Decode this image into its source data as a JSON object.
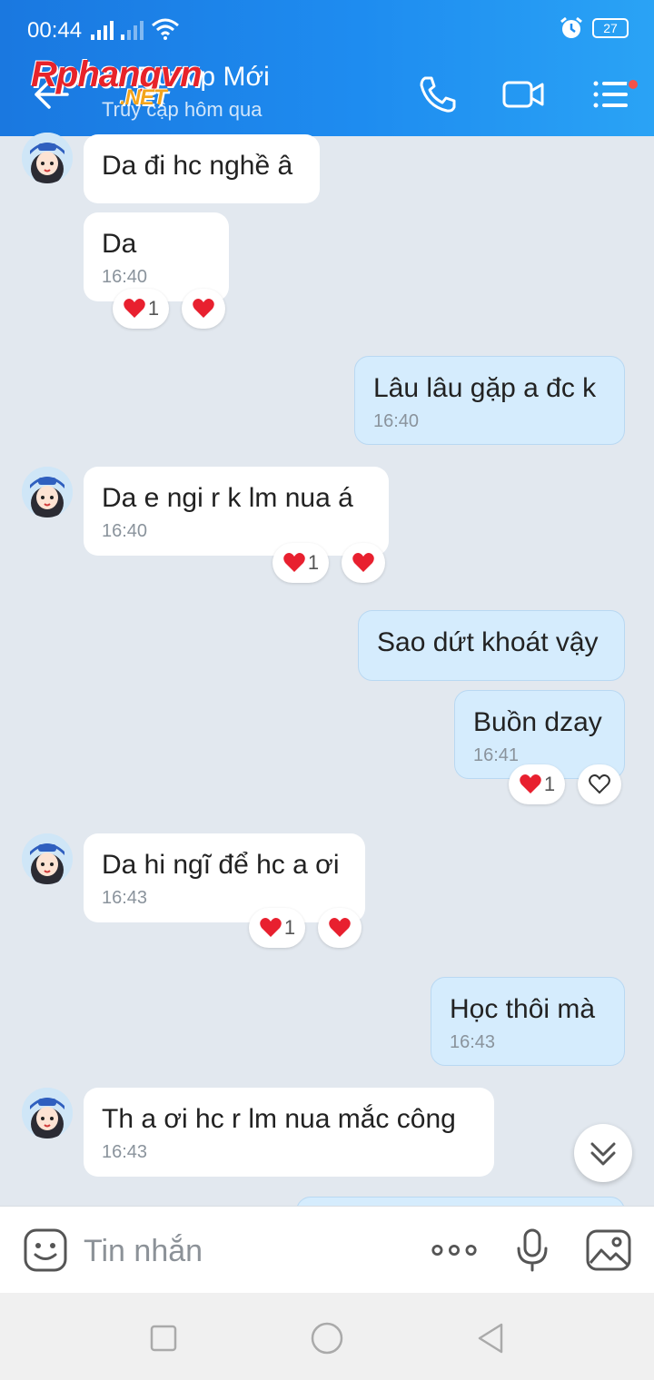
{
  "status_bar": {
    "time": "00:44",
    "battery": "27"
  },
  "header": {
    "contact_name": "Đ. Dư Vp Mới",
    "last_seen": "Truy cập hôm qua",
    "watermark": "Rphangvn",
    "watermark_suffix": ".NET"
  },
  "messages": [
    {
      "direction": "in",
      "text": "Da đi hc nghề â",
      "time": ""
    },
    {
      "direction": "in",
      "text": "Da",
      "time": "16:40",
      "reactions": [
        "1"
      ]
    },
    {
      "direction": "out",
      "text": "Lâu lâu gặp a đc k",
      "time": "16:40"
    },
    {
      "direction": "in",
      "text": "Da e ngi  r k lm nua á",
      "time": "16:40",
      "reactions": [
        "1"
      ]
    },
    {
      "direction": "out",
      "text": "Sao dứt khoát vậy",
      "time": ""
    },
    {
      "direction": "out",
      "text": "Buồn dzay",
      "time": "16:41",
      "reactions": [
        "1"
      ]
    },
    {
      "direction": "in",
      "text": "Da hi ngĩ để hc a ơi",
      "time": "16:43",
      "reactions": [
        "1"
      ]
    },
    {
      "direction": "out",
      "text": "Học thôi mà",
      "time": "16:43"
    },
    {
      "direction": "in",
      "text": "Th a ơi hc r lm nua mắc công",
      "time": "16:43"
    }
  ],
  "composer": {
    "placeholder": "Tin nhắn"
  },
  "colors": {
    "header": "#1e8cf0",
    "incoming": "#ffffff",
    "outgoing": "#d5ecfd",
    "background": "#e2e8ef",
    "heart": "#e8202f"
  }
}
